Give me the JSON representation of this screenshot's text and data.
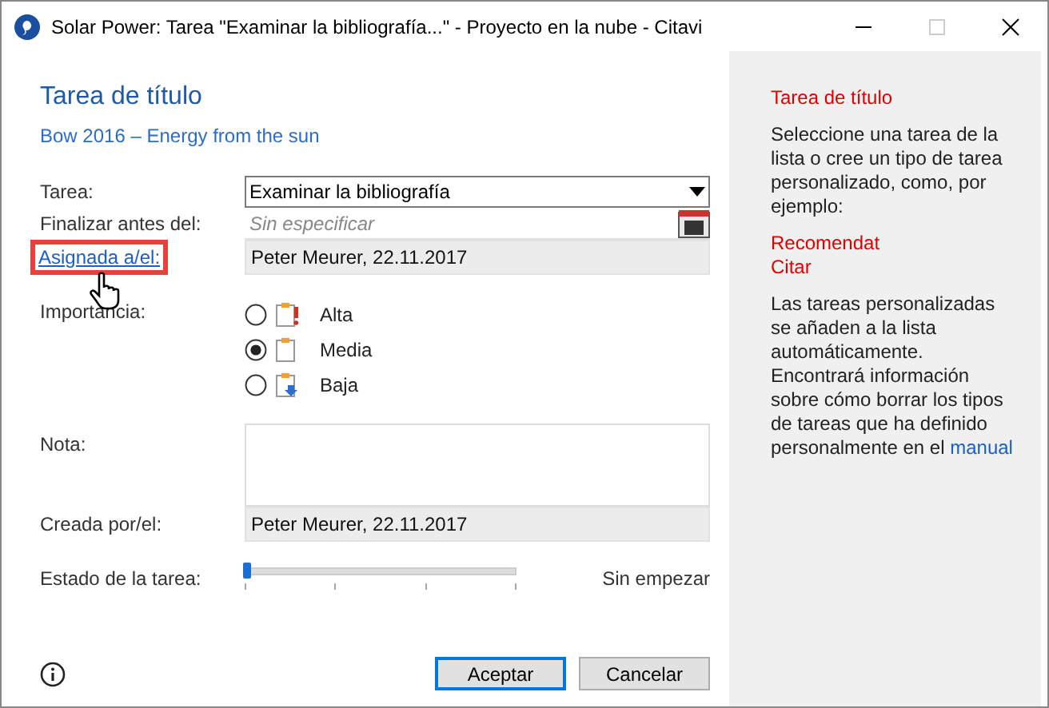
{
  "window": {
    "title": "Solar Power: Tarea \"Examinar la bibliografía...\" - Proyecto en la nube - Citavi"
  },
  "heading": "Tarea de título",
  "reference": "Bow 2016 – Energy from the sun",
  "fields": [
    {
      "kind": "dropdown",
      "label": "Tarea:",
      "value": "Examinar la bibliografía"
    },
    {
      "kind": "date",
      "label": "Finalizar antes del:",
      "placeholder": "Sin especificar"
    },
    {
      "kind": "readonly",
      "label": "Asignada a/el:",
      "link": true,
      "highlighted": true,
      "value": "Peter Meurer, 22.11.2017"
    }
  ],
  "importance": {
    "label": "Importancia:",
    "options": [
      {
        "label": "Alta",
        "selected": false,
        "kind": "high"
      },
      {
        "label": "Media",
        "selected": true,
        "kind": "normal"
      },
      {
        "label": "Baja",
        "selected": false,
        "kind": "low"
      }
    ]
  },
  "note": {
    "label": "Nota:"
  },
  "created": {
    "label": "Creada por/el:",
    "value": "Peter Meurer, 22.11.2017"
  },
  "status": {
    "label": "Estado de la tarea:",
    "level": 0,
    "reading": "Sin empezar"
  },
  "buttons": [
    {
      "label": "Aceptar",
      "default": true
    },
    {
      "label": "Cancelar",
      "default": false
    }
  ],
  "help": {
    "title": "Tarea de título",
    "intro": "Seleccione una tarea de la lista o cree un tipo de tarea personalizado, como, por ejemplo:",
    "examples": [
      "Recomendat",
      "Citar"
    ],
    "text": "Las tareas personalizadas se añaden a la lista automáticamente. Encontrará información sobre cómo borrar los tipos de tareas que ha definido personalmente en el",
    "link": "manual"
  }
}
